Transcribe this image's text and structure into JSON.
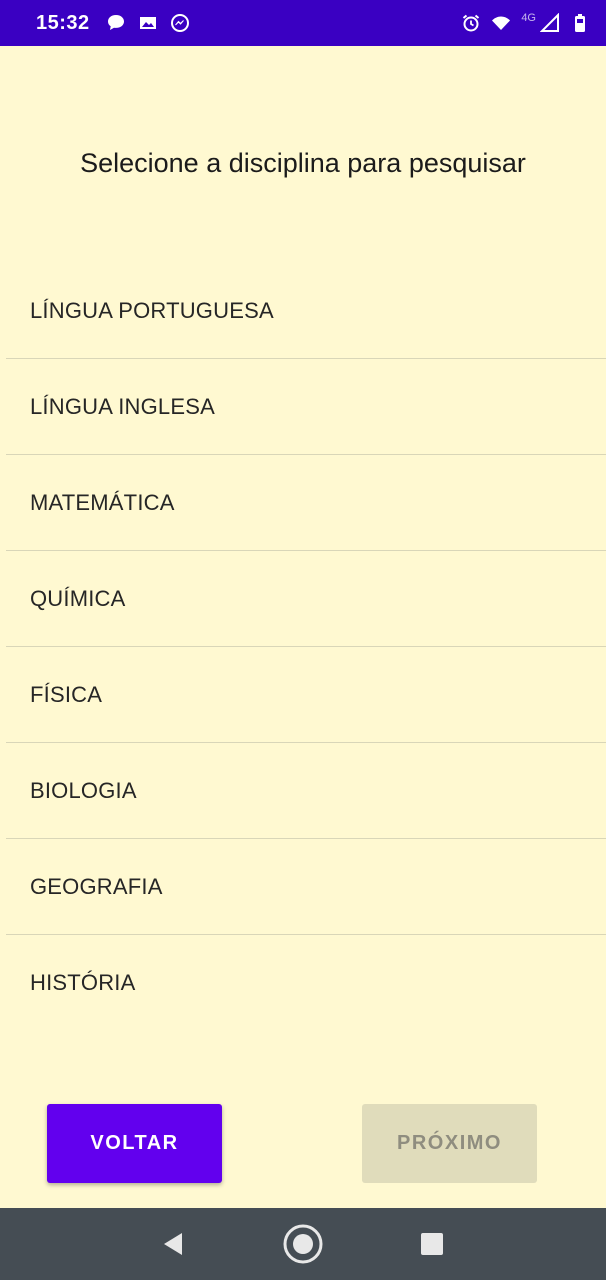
{
  "status_bar": {
    "time": "15:32",
    "network": "4G",
    "icons": [
      "chat-bubble-icon",
      "photo-icon",
      "messenger-icon",
      "alarm-icon",
      "wifi-icon",
      "signal-icon",
      "battery-icon"
    ]
  },
  "title": "Selecione a disciplina para pesquisar",
  "subjects": [
    "LÍNGUA PORTUGUESA",
    "LÍNGUA INGLESA",
    "MATEMÁTICA",
    "QUÍMICA",
    "FÍSICA",
    "BIOLOGIA",
    "GEOGRAFIA",
    "HISTÓRIA"
  ],
  "buttons": {
    "back": "VOLTAR",
    "next": "PRÓXIMO"
  },
  "colors": {
    "status_bar": "#3a00c2",
    "background": "#fff9d1",
    "primary": "#6200ee",
    "disabled": "#e0dcbb",
    "nav_bar": "#454d54"
  },
  "nav_bar": {
    "icons": [
      "back-triangle-icon",
      "home-circle-icon",
      "recents-square-icon"
    ]
  }
}
